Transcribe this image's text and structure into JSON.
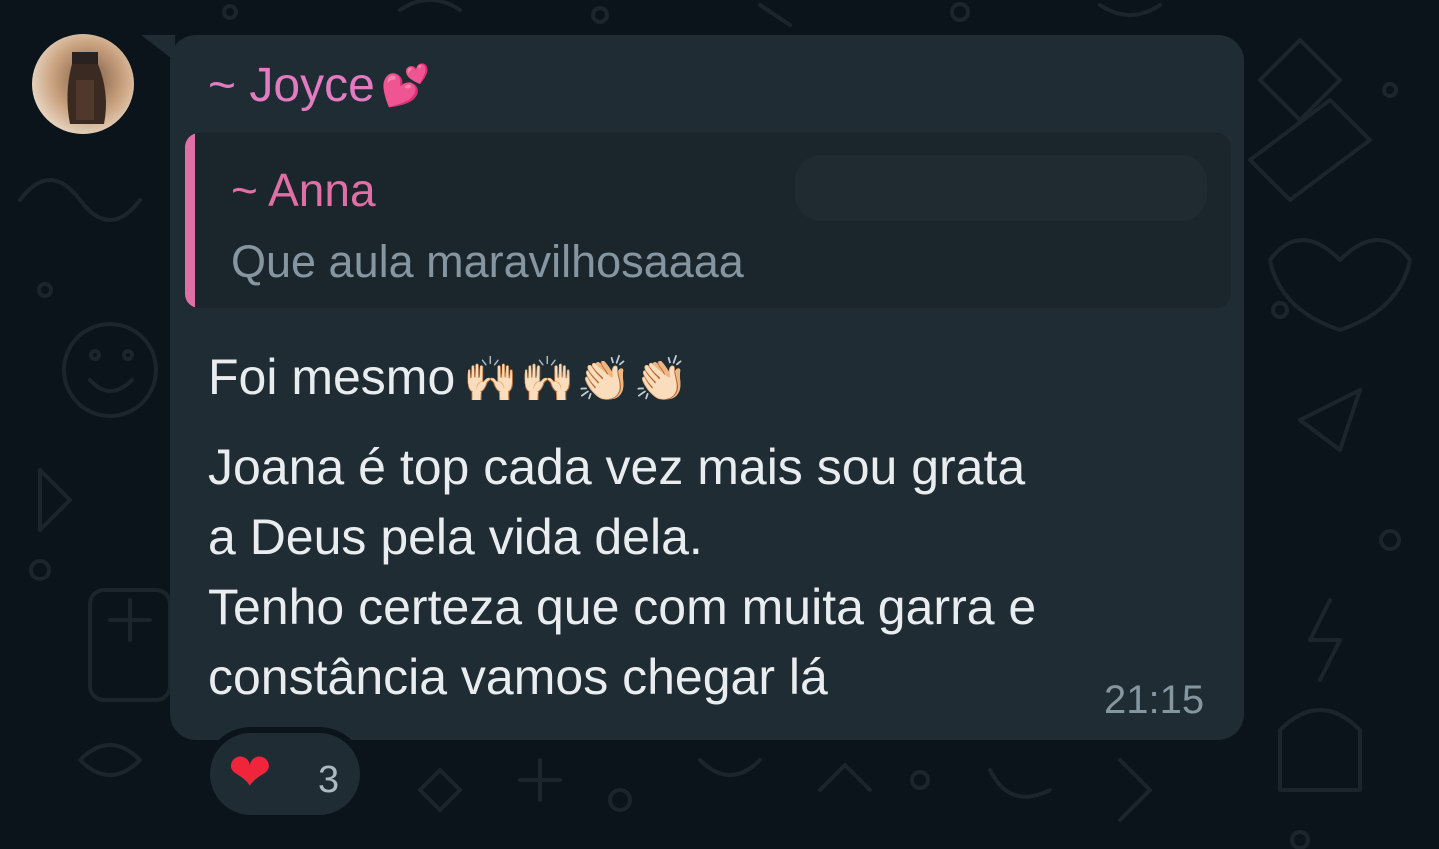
{
  "colors": {
    "background": "#0b141a",
    "bubble": "#1f2c33",
    "sender_name": "#e37bc2",
    "quote_accent": "#e06fa6",
    "message_text": "#e9edef",
    "muted_text": "#8696a0"
  },
  "message": {
    "sender": "~ Joyce",
    "sender_emoji": "💕",
    "quote": {
      "author": "~ Anna",
      "text": "Que aula maravilhosaaaa"
    },
    "line1_text": "Foi mesmo",
    "line1_emojis": "🙌🏻🙌🏻👏🏻👏🏻",
    "lines": [
      "Joana é top cada vez mais sou grata",
      "a Deus pela vida dela.",
      "Tenho certeza que com muita garra e",
      "constância vamos chegar lá"
    ],
    "time": "21:15"
  },
  "reaction": {
    "emoji": "❤",
    "count": "3"
  }
}
